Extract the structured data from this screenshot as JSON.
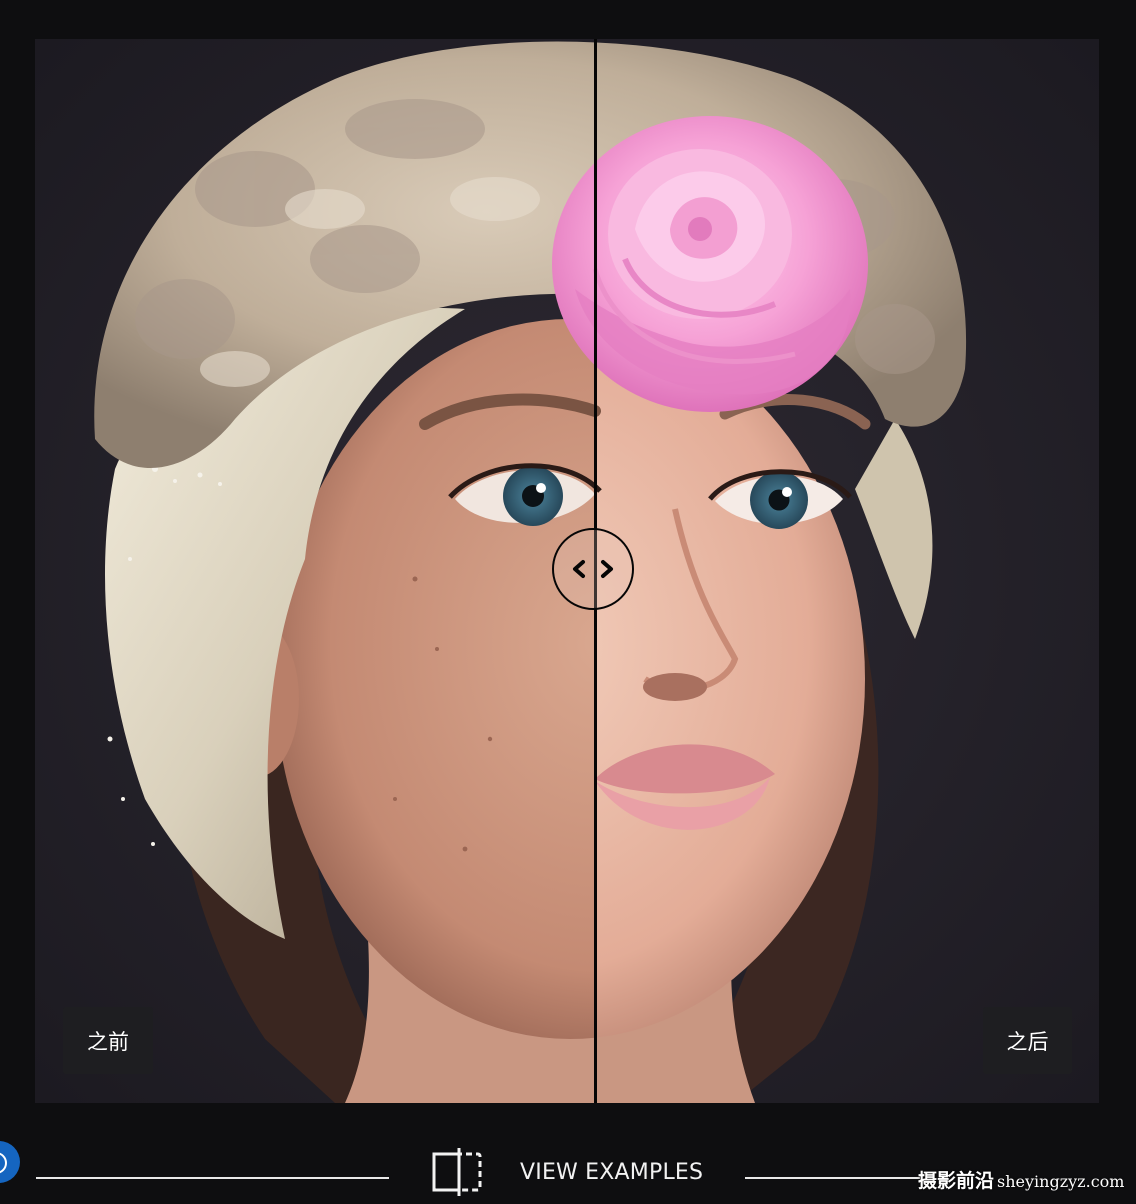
{
  "comparison": {
    "before_label": "之前",
    "after_label": "之后",
    "image": "portrait-woman-fur-hat-pink-rose",
    "handle_icon": "chevron-left-right-icon"
  },
  "footer": {
    "view_examples_label": "VIEW EXAMPLES",
    "view_examples_icon": "crop-selection-icon"
  },
  "watermark": {
    "chinese": "摄影前沿",
    "latin": "sheyingzyz.com"
  },
  "colors": {
    "background": "#0e0e10",
    "badge": "#1e1e22",
    "accent_blue": "#1565c0",
    "rose": "#f4a8d4"
  }
}
